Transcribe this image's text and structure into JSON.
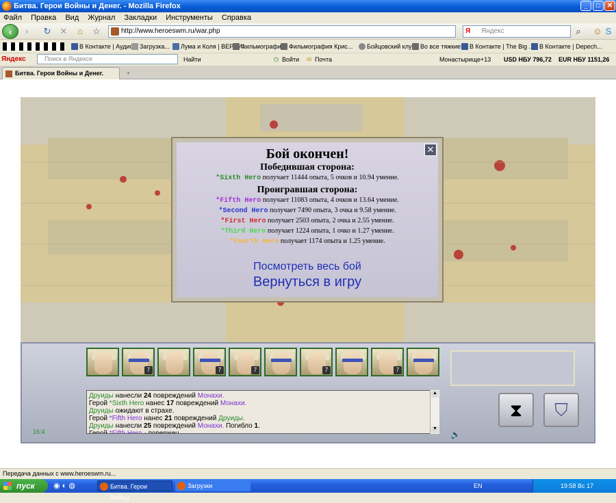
{
  "window": {
    "title": "Битва. Герои Войны и Денег. - Mozilla Firefox"
  },
  "menu": [
    "Файл",
    "Правка",
    "Вид",
    "Журнал",
    "Закладки",
    "Инструменты",
    "Справка"
  ],
  "nav": {
    "url": "http://www.heroeswm.ru/war.php",
    "search_placeholder": "Яндекс",
    "search_engine": "Я"
  },
  "bookmarks": [
    "В Контакте | Аудио",
    "Загрузка...",
    "Лума и Коля | ВЕРНИ...",
    "Фильмографии",
    "Фильмография Крис...",
    "Бойцовский клуб",
    "Во все тяжкие",
    "В Контакте | The Big ...",
    "В Контакте | Depech..."
  ],
  "yandex_bar": {
    "logo": "Яндекс",
    "placeholder": "Поиск в Яндексе",
    "find": "Найти",
    "login": "Войти",
    "mail": "Почта",
    "city": "Монастырище",
    "weather": "+13",
    "usd": "USD НБУ 796,72",
    "eur": "EUR НБУ 1151,26"
  },
  "tab": {
    "label": "Битва. Герои Войны и Денег."
  },
  "dialog": {
    "title": "Бой окончен!",
    "winners_heading": "Победившая сторона:",
    "losers_heading": "Проигравшая сторона:",
    "winners": [
      {
        "name": "*Sixth Hero",
        "color": "#2c8a2c",
        "text": " получает 11444 опыта, 5 очков и 10.94 умение."
      }
    ],
    "losers": [
      {
        "name": "*Fifth Hero",
        "color": "#a12fd6",
        "text": " получает 11083 опыта, 4 очков и 13.64 умение."
      },
      {
        "name": "*Second Hero",
        "color": "#2636c8",
        "text": " получает 7490 опыта, 3 очка и 9.58 умение."
      },
      {
        "name": "*First Hero",
        "color": "#d42a2a",
        "text": " получает 2503 опыта, 2 очка и 2.55 умение."
      },
      {
        "name": "*Third Hero",
        "color": "#49d84a",
        "text": " получает 1224 опыта, 1 очко и 1.27 умение."
      },
      {
        "name": "*Fourth Hero",
        "color": "#f2b83a",
        "text": " получает 1174 опыта и 1.25 умение."
      }
    ],
    "link_view": "Посмотреть весь бой",
    "link_return": "Вернуться в игру"
  },
  "units": [
    {
      "count": ""
    },
    {
      "count": "7"
    },
    {
      "count": ""
    },
    {
      "count": "7"
    },
    {
      "count": "7"
    },
    {
      "count": ""
    },
    {
      "count": "7"
    },
    {
      "count": ""
    },
    {
      "count": "7"
    },
    {
      "count": ""
    }
  ],
  "log": [
    [
      {
        "t": "Друиды",
        "c": "g"
      },
      {
        "t": " нанесли "
      },
      {
        "t": "24",
        "b": true
      },
      {
        "t": " повреждений "
      },
      {
        "t": "Монахи.",
        "c": "p"
      }
    ],
    [
      {
        "t": "Герой "
      },
      {
        "t": "*Sixth Hero",
        "c": "g"
      },
      {
        "t": " нанес "
      },
      {
        "t": "17",
        "b": true
      },
      {
        "t": " повреждений "
      },
      {
        "t": "Монахи.",
        "c": "p"
      }
    ],
    [
      {
        "t": "Друиды",
        "c": "g"
      },
      {
        "t": " ожидают в страхе."
      }
    ],
    [
      {
        "t": "Герой "
      },
      {
        "t": "*Fifth Hero",
        "c": "p"
      },
      {
        "t": " нанес "
      },
      {
        "t": "21",
        "b": true
      },
      {
        "t": " повреждений "
      },
      {
        "t": "Друиды.",
        "c": "g"
      }
    ],
    [
      {
        "t": "Друиды",
        "c": "g"
      },
      {
        "t": " нанесли "
      },
      {
        "t": "25",
        "b": true
      },
      {
        "t": " повреждений "
      },
      {
        "t": "Монахи.",
        "c": "p"
      },
      {
        "t": " Погибло "
      },
      {
        "t": "1",
        "b": true
      },
      {
        "t": "."
      }
    ],
    [
      {
        "t": "Герой "
      },
      {
        "t": "*Fifth Hero",
        "c": "p"
      },
      {
        "t": " - повержен."
      }
    ]
  ],
  "battle_time": "16:4",
  "status": "Передача данных с www.heroeswm.ru...",
  "taskbar": {
    "start": "пуск",
    "tasks": [
      "Битва. Герои Войны...",
      "Загрузки"
    ],
    "lang": "EN",
    "clock": "19:58 Вс 17"
  }
}
